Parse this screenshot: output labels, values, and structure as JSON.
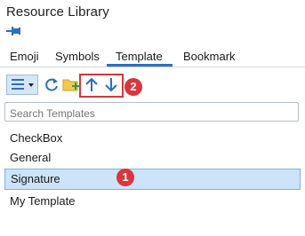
{
  "window": {
    "title": "Resource Library"
  },
  "icons": {
    "pin": "pin-icon"
  },
  "tabs": [
    {
      "label": "Emoji"
    },
    {
      "label": "Symbols"
    },
    {
      "label": "Template",
      "active": true
    },
    {
      "label": "Bookmark"
    }
  ],
  "toolbar": {
    "view_menu": "list-view-icon",
    "refresh": "refresh-icon",
    "new_folder": "new-folder-icon",
    "move_up": "arrow-up-icon",
    "move_down": "arrow-down-icon"
  },
  "search": {
    "placeholder": "Search Templates"
  },
  "templates": [
    {
      "name": "CheckBox"
    },
    {
      "name": "General"
    },
    {
      "name": "Signature",
      "selected": true
    },
    {
      "name": "My Template"
    }
  ],
  "annotations": [
    {
      "label": "1",
      "color": "#d9363e"
    },
    {
      "label": "2",
      "color": "#d9363e"
    }
  ]
}
